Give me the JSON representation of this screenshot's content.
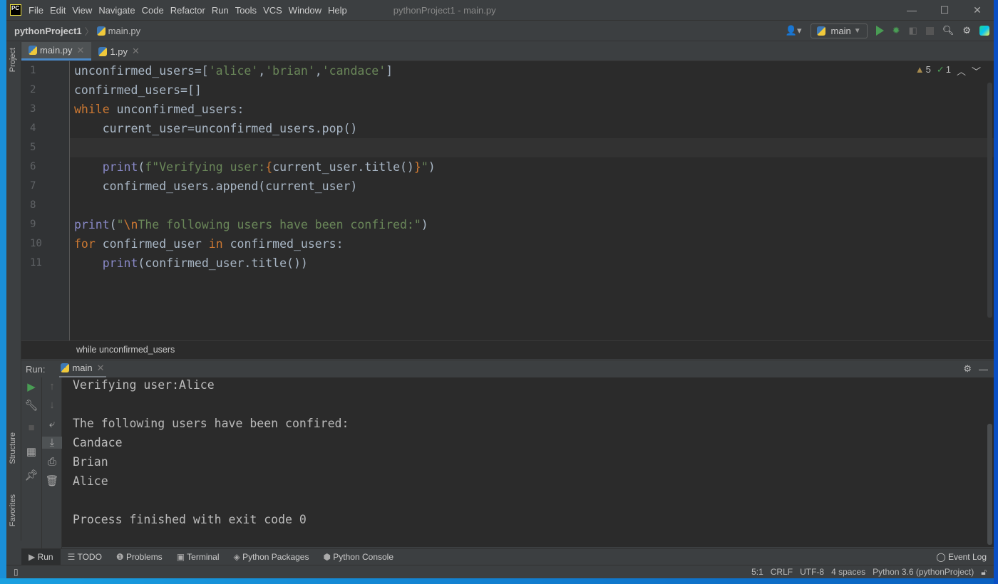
{
  "menu": [
    "File",
    "Edit",
    "View",
    "Navigate",
    "Code",
    "Refactor",
    "Run",
    "Tools",
    "VCS",
    "Window",
    "Help"
  ],
  "window_title": "pythonProject1 - main.py",
  "window_controls": {
    "minimize": "—",
    "maximize": "☐",
    "close": "✕"
  },
  "breadcrumb": {
    "project": "pythonProject1",
    "file": "main.py"
  },
  "toolbar": {
    "run_config": "main"
  },
  "tabs": [
    {
      "label": "main.py",
      "active": true
    },
    {
      "label": "1.py",
      "active": false
    }
  ],
  "side_labels": {
    "project": "Project",
    "structure": "Structure",
    "favorites": "Favorites"
  },
  "inspections": {
    "warnings": "5",
    "weak_warnings": "1"
  },
  "code_lines": [
    [
      [
        "t",
        "unconfirmed_users=["
      ],
      [
        "str",
        "'alice'"
      ],
      [
        "t",
        ","
      ],
      [
        "str",
        "'brian'"
      ],
      [
        "t",
        ","
      ],
      [
        "str",
        "'candace'"
      ],
      [
        "t",
        "]"
      ]
    ],
    [
      [
        "t",
        "confirmed_users=[]"
      ]
    ],
    [
      [
        "kw",
        "while"
      ],
      [
        "t",
        " unconfirmed_users:"
      ]
    ],
    [
      [
        "t",
        "    current_user=unconfirmed_users.pop()"
      ]
    ],
    [],
    [
      [
        "t",
        "    "
      ],
      [
        "fn",
        "print"
      ],
      [
        "t",
        "("
      ],
      [
        "str",
        "f\"Verifying user:"
      ],
      [
        "kw",
        "{"
      ],
      [
        "t",
        "current_user.title()"
      ],
      [
        "kw",
        "}"
      ],
      [
        "str",
        "\""
      ],
      [
        "t",
        ")"
      ]
    ],
    [
      [
        "t",
        "    confirmed_users.append(current_user)"
      ]
    ],
    [],
    [
      [
        "fn",
        "print"
      ],
      [
        "t",
        "("
      ],
      [
        "str",
        "\""
      ],
      [
        "esc",
        "\\n"
      ],
      [
        "str",
        "The following users have been confired:\""
      ],
      [
        "t",
        ")"
      ]
    ],
    [
      [
        "kw",
        "for"
      ],
      [
        "t",
        " confirmed_user "
      ],
      [
        "kw",
        "in"
      ],
      [
        "t",
        " confirmed_users:"
      ]
    ],
    [
      [
        "t",
        "    "
      ],
      [
        "fn",
        "print"
      ],
      [
        "t",
        "(confirmed_user.title())"
      ]
    ]
  ],
  "editor_breadcrumb": "while unconfirmed_users",
  "run_panel": {
    "label": "Run:",
    "tab": "main"
  },
  "console_output": [
    "Verifying user:Alice",
    "",
    "The following users have been confired:",
    "Candace",
    "Brian",
    "Alice",
    "",
    "Process finished with exit code 0"
  ],
  "bottom_tabs": [
    "Run",
    "TODO",
    "Problems",
    "Terminal",
    "Python Packages",
    "Python Console"
  ],
  "event_log": "Event Log",
  "status": {
    "position": "5:1",
    "line_sep": "CRLF",
    "encoding": "UTF-8",
    "indent": "4 spaces",
    "interpreter": "Python 3.6 (pythonProject)"
  }
}
